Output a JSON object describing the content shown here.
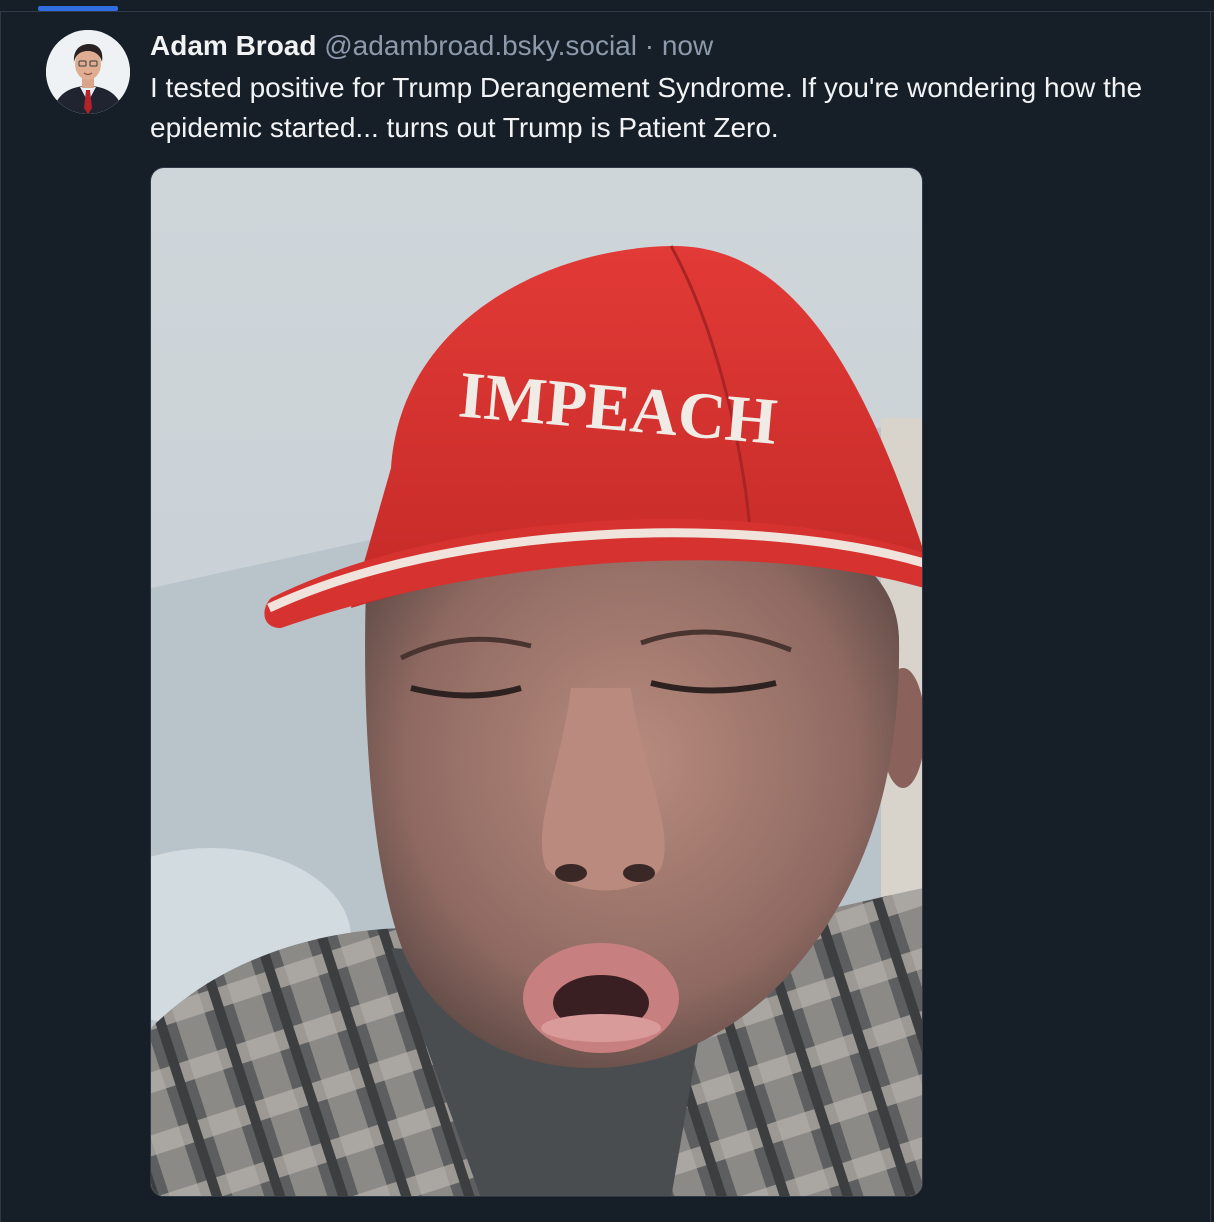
{
  "post": {
    "author": {
      "display_name": "Adam Broad",
      "handle": "@adambroad.bsky.social",
      "avatar_icon": "person-portrait-avatar"
    },
    "separator": "·",
    "timestamp": "now",
    "text": "I tested positive for Trump Derangement Syndrome. If you're wondering how the epidemic started... turns out Trump is Patient Zero.",
    "image": {
      "hat_text": "IMPEACH",
      "hat_color": "#d7312f"
    }
  },
  "colors": {
    "background": "#161e27",
    "accent": "#2f6ee0",
    "text_primary": "#f1f3f5",
    "text_secondary": "#8c9aab"
  }
}
